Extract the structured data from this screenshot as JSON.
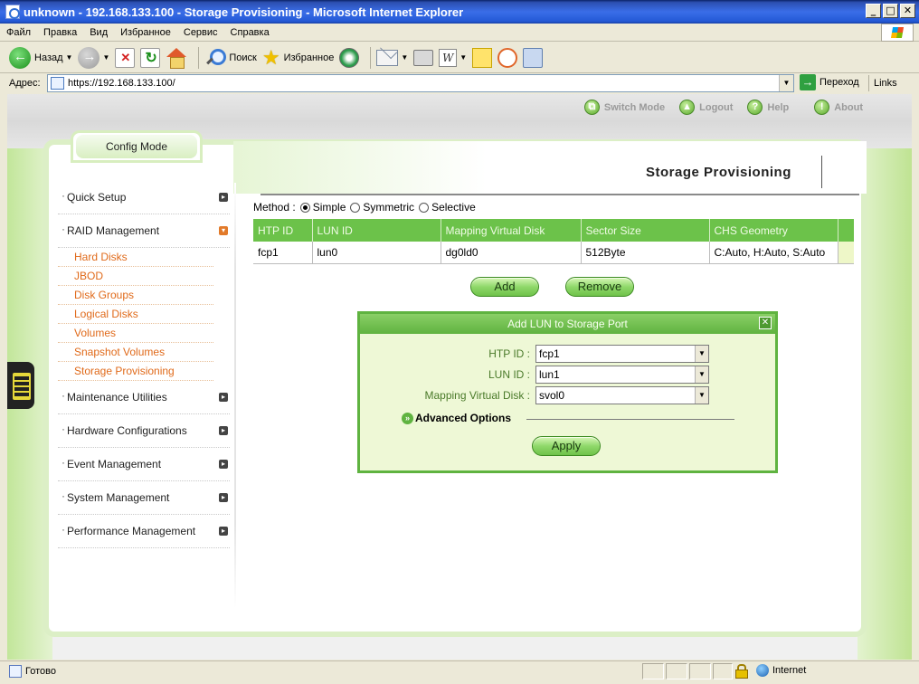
{
  "window": {
    "title": "unknown - 192.168.133.100 - Storage Provisioning - Microsoft Internet Explorer",
    "buttons": {
      "minimize": "_",
      "maximize": "□",
      "close": "✕"
    }
  },
  "menubar": [
    "Файл",
    "Правка",
    "Вид",
    "Избранное",
    "Сервис",
    "Справка"
  ],
  "toolbar": {
    "back": "Назад",
    "search": "Поиск",
    "favorites": "Избранное"
  },
  "addressbar": {
    "label": "Адрес:",
    "url": "https://192.168.133.100/",
    "go": "Переход",
    "links": "Links"
  },
  "topnav": {
    "switch_mode": "Switch Mode",
    "logout": "Logout",
    "help": "Help",
    "about": "About"
  },
  "mode_tab": "Config Mode",
  "page_title": "Storage Provisioning",
  "sidebar": {
    "groups": [
      {
        "label": "Quick Setup"
      },
      {
        "label": "RAID Management",
        "expanded": true,
        "items": [
          "Hard Disks",
          "JBOD",
          "Disk Groups",
          "Logical Disks",
          "Volumes",
          "Snapshot Volumes",
          "Storage Provisioning"
        ]
      },
      {
        "label": "Maintenance Utilities"
      },
      {
        "label": "Hardware Configurations"
      },
      {
        "label": "Event Management"
      },
      {
        "label": "System Management"
      },
      {
        "label": "Performance Management"
      }
    ]
  },
  "method": {
    "label": "Method :",
    "options": [
      "Simple",
      "Symmetric",
      "Selective"
    ],
    "selected": "Simple"
  },
  "lun_table": {
    "columns": [
      "HTP ID",
      "LUN ID",
      "Mapping Virtual Disk",
      "Sector Size",
      "CHS Geometry"
    ],
    "rows": [
      [
        "fcp1",
        "lun0",
        "dg0ld0",
        "512Byte",
        "C:Auto, H:Auto, S:Auto"
      ]
    ]
  },
  "actions": {
    "add": "Add",
    "remove": "Remove"
  },
  "dialog": {
    "title": "Add LUN to Storage Port",
    "fields": [
      {
        "label": "HTP ID :",
        "value": "fcp1"
      },
      {
        "label": "LUN ID :",
        "value": "lun1"
      },
      {
        "label": "Mapping Virtual Disk :",
        "value": "svol0"
      }
    ],
    "advanced": "Advanced Options",
    "apply": "Apply"
  },
  "statusbar": {
    "status": "Готово",
    "zone": "Internet"
  },
  "colors": {
    "accent_green": "#6cc24a",
    "sidebar_sub": "#e06a1a",
    "xp_title": "#2459d6"
  }
}
